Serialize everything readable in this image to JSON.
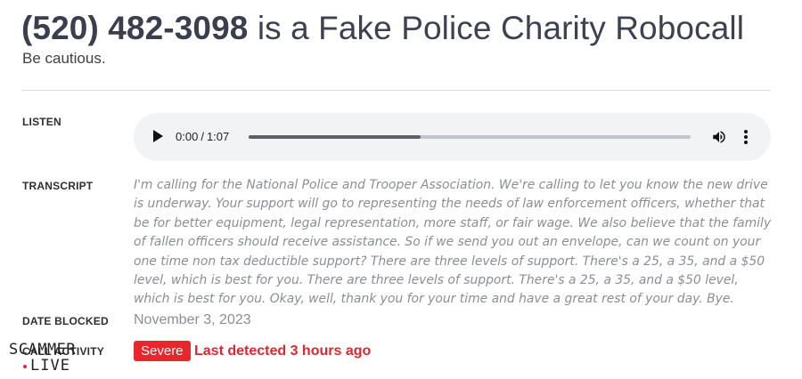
{
  "header": {
    "phone": "(520) 482-3098",
    "title_rest": "is a Fake Police Charity Robocall",
    "subtitle": "Be cautious."
  },
  "labels": {
    "listen": "LISTEN",
    "transcript": "TRANSCRIPT",
    "date_blocked": "DATE BLOCKED",
    "call_activity": "CALL ACTIVITY"
  },
  "audio": {
    "current_time": "0:00",
    "separator": "/",
    "duration": "1:07",
    "buffered_fraction": 0.39
  },
  "transcript": "I'm calling for the National Police and Trooper Association. We're calling to let you know the new drive is underway. Your support will go to representing the needs of law enforcement officers, whether that be for better equipment, legal representation, more staff, or fair wage. We also believe that the family of fallen officers should receive assistance. So if we send you out an envelope, can we count on your one time non tax deductible support? There are three levels of support. There's a 25, a 35, and a $50 level, which is best for you. There are three levels of support. There's a 25, a 35, and a $50 level, which is best for you. Okay, well, thank you for your time and have a great rest of your day. Bye.",
  "date_blocked": "November 3, 2023",
  "activity": {
    "severity": "Severe",
    "last_detected": "Last detected 3 hours ago"
  },
  "watermark": {
    "line1": "SCAMMER",
    "line2": ".LIVE"
  },
  "colors": {
    "accent_red": "#e8262e",
    "title": "#3d4150",
    "muted_text": "#8a8e96",
    "player_bg": "#f1f3f4"
  },
  "icons": [
    "play-icon",
    "volume-icon",
    "more-vert-icon"
  ]
}
